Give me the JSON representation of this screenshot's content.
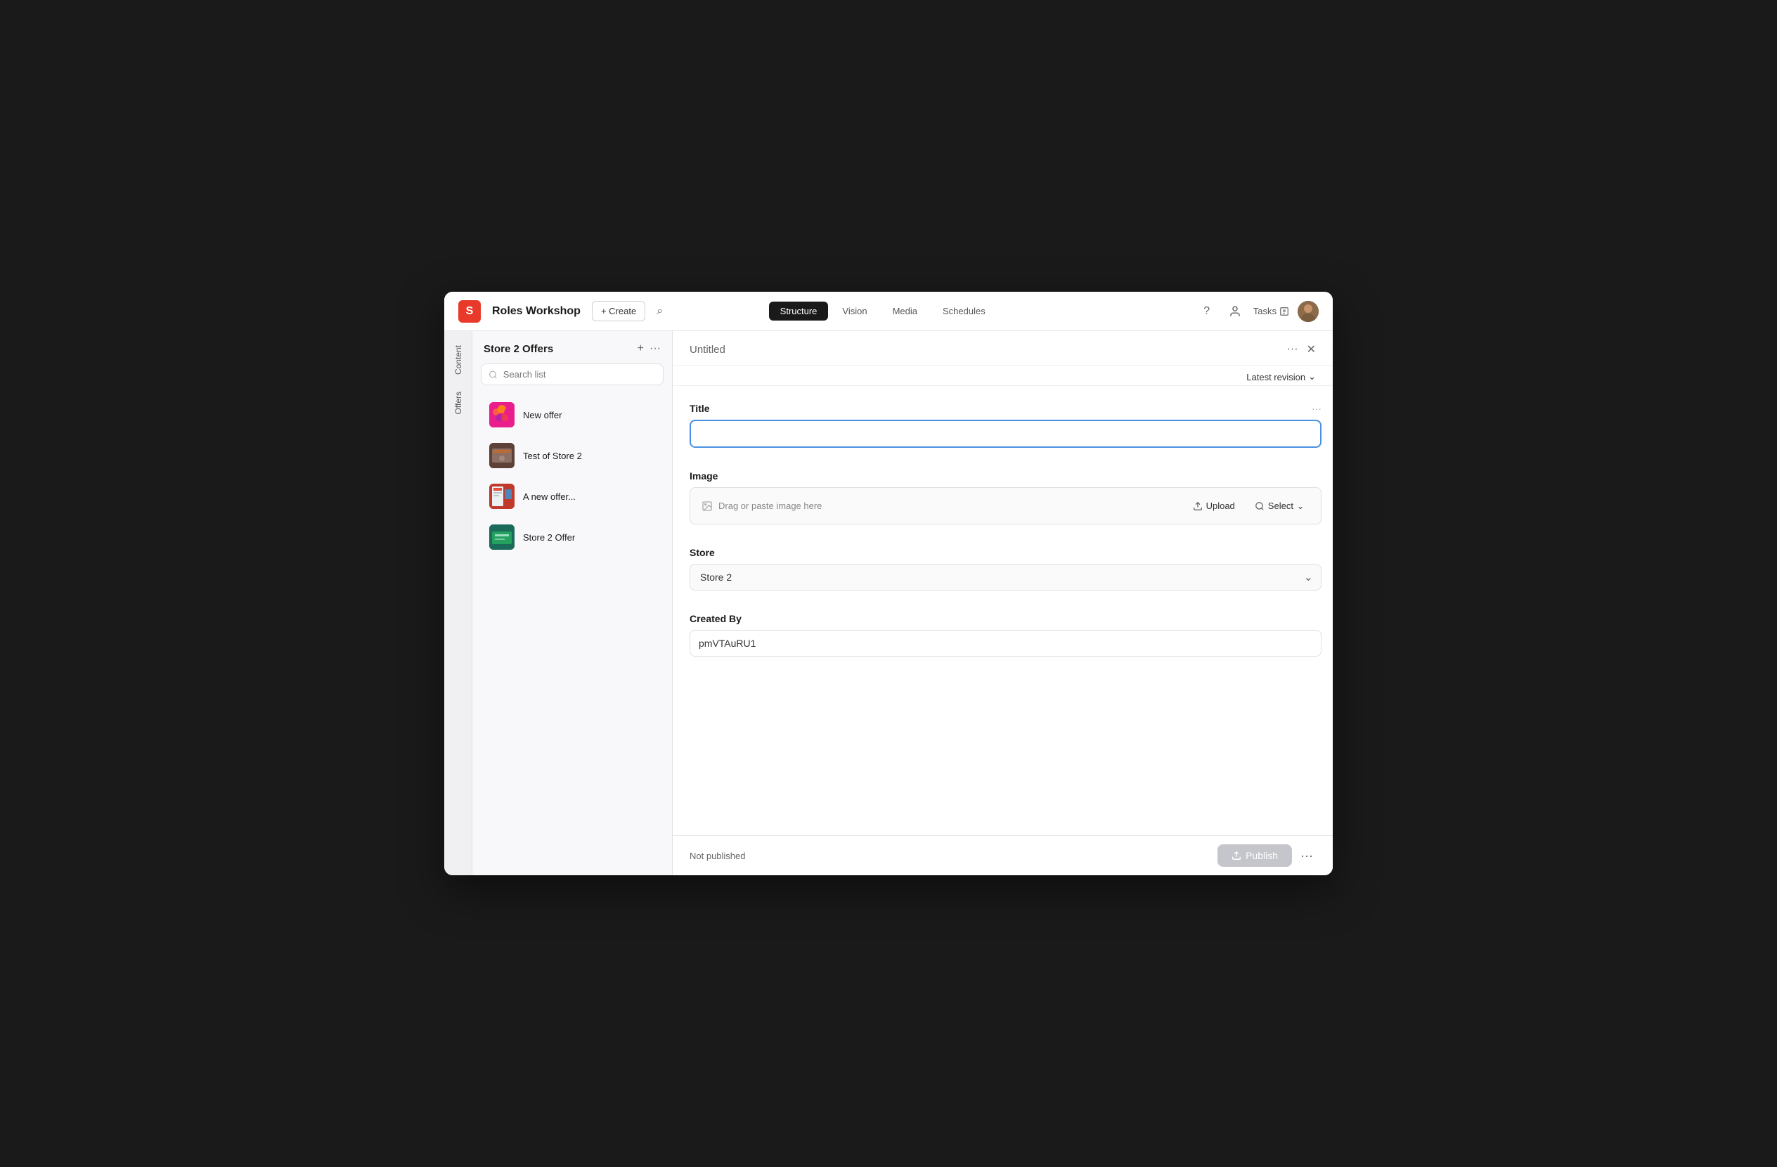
{
  "app": {
    "logo": "S",
    "title": "Roles Workshop",
    "create_label": "+ Create"
  },
  "nav": {
    "tabs": [
      {
        "id": "structure",
        "label": "Structure",
        "active": true
      },
      {
        "id": "vision",
        "label": "Vision",
        "active": false
      },
      {
        "id": "media",
        "label": "Media",
        "active": false
      },
      {
        "id": "schedules",
        "label": "Schedules",
        "active": false
      }
    ],
    "tasks_label": "Tasks",
    "help_icon": "?",
    "user_icon": "person"
  },
  "sidebar": {
    "content_tab": "Content",
    "offers_tab": "Offers"
  },
  "offers_panel": {
    "title": "Store 2 Offers",
    "search_placeholder": "Search list",
    "items": [
      {
        "id": 1,
        "name": "New offer",
        "thumb_class": "thumb-1"
      },
      {
        "id": 2,
        "name": "Test of Store 2",
        "thumb_class": "thumb-2"
      },
      {
        "id": 3,
        "name": "A new offer...",
        "thumb_class": "thumb-3"
      },
      {
        "id": 4,
        "name": "Store 2 Offer",
        "thumb_class": "thumb-4"
      }
    ]
  },
  "content": {
    "document_title": "Untitled",
    "revision_label": "Latest revision",
    "fields": {
      "title_label": "Title",
      "title_value": "",
      "image_label": "Image",
      "drag_placeholder": "Drag or paste image here",
      "upload_label": "Upload",
      "select_label": "Select",
      "store_label": "Store",
      "store_value": "Store 2",
      "created_by_label": "Created By",
      "created_by_value": "pmVTAuRU1"
    }
  },
  "footer": {
    "status": "Not published",
    "publish_label": "Publish"
  },
  "icons": {
    "plus": "+",
    "ellipsis": "···",
    "search": "⌕",
    "close": "✕",
    "chevron_down": "⌄",
    "image": "🖼",
    "upload": "↑",
    "magnify": "⌕",
    "publish_up": "↑"
  }
}
